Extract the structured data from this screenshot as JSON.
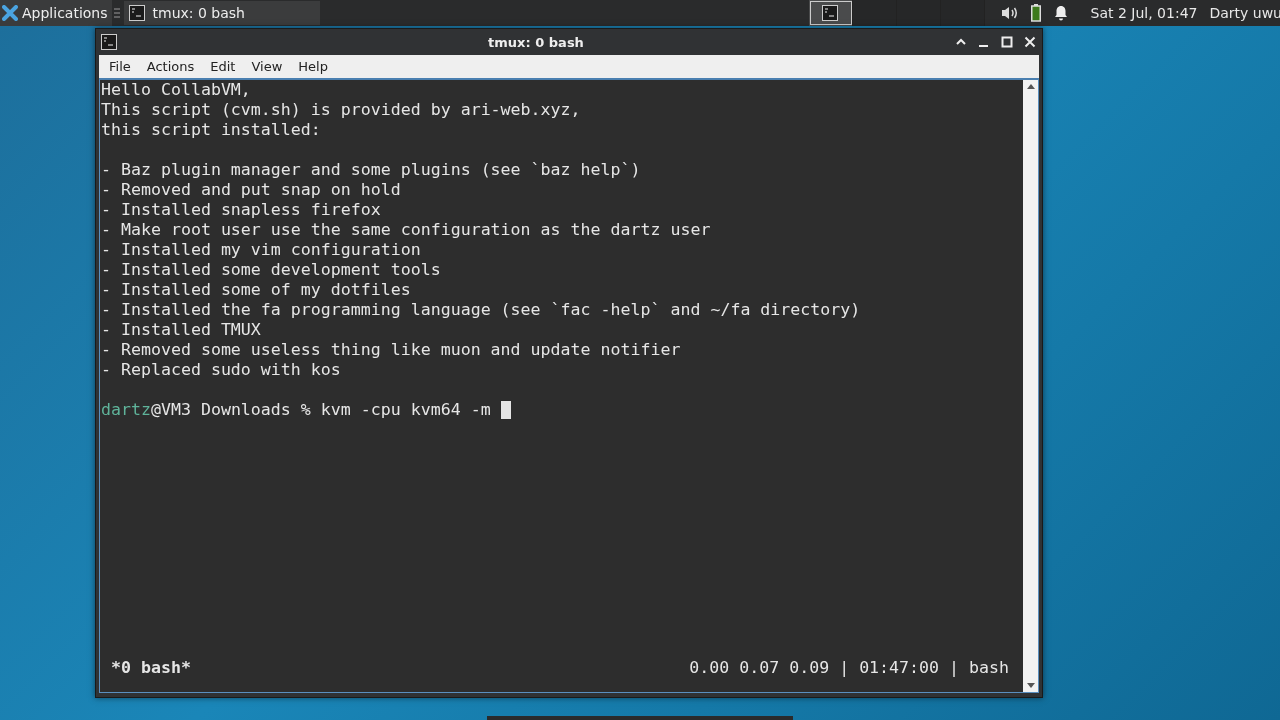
{
  "top_panel": {
    "applications_label": "Applications",
    "tasks": [
      {
        "label": "tmux: 0 bash",
        "selected": true
      }
    ],
    "workspaces": [
      {
        "selected": true,
        "has_window": true
      },
      {
        "selected": false,
        "has_window": false
      },
      {
        "selected": false,
        "has_window": false
      },
      {
        "selected": false,
        "has_window": false
      }
    ],
    "clock": "Sat  2 Jul, 01:47",
    "user": "Darty uwu"
  },
  "window": {
    "title": "tmux: 0 bash",
    "menu": [
      "File",
      "Actions",
      "Edit",
      "View",
      "Help"
    ]
  },
  "terminal": {
    "lines": [
      {
        "kind": "text",
        "text": "Hello CollabVM,"
      },
      {
        "kind": "text",
        "text": "This script (cvm.sh) is provided by ari-web.xyz,"
      },
      {
        "kind": "text",
        "text": "this script installed:"
      },
      {
        "kind": "blank"
      },
      {
        "kind": "text",
        "text": "- Baz plugin manager and some plugins (see `baz help`)"
      },
      {
        "kind": "text",
        "text": "- Removed and put snap on hold"
      },
      {
        "kind": "text",
        "text": "- Installed snapless firefox"
      },
      {
        "kind": "text",
        "text": "- Make root user use the same configuration as the dartz user"
      },
      {
        "kind": "text",
        "text": "- Installed my vim configuration"
      },
      {
        "kind": "text",
        "text": "- Installed some development tools"
      },
      {
        "kind": "text",
        "text": "- Installed some of my dotfiles"
      },
      {
        "kind": "text",
        "text": "- Installed the fa programming language (see `fac -help` and ~/fa directory)"
      },
      {
        "kind": "text",
        "text": "- Installed TMUX"
      },
      {
        "kind": "text",
        "text": "- Removed some useless thing like muon and update notifier"
      },
      {
        "kind": "text",
        "text": "- Replaced sudo with kos"
      },
      {
        "kind": "blank"
      },
      {
        "kind": "prompt",
        "user": "dartz",
        "text": "@VM3 Downloads % kvm -cpu kvm64 -m "
      }
    ],
    "status_left": "*0 bash*",
    "status_right": "0.00 0.07 0.09 | 01:47:00 | bash"
  }
}
